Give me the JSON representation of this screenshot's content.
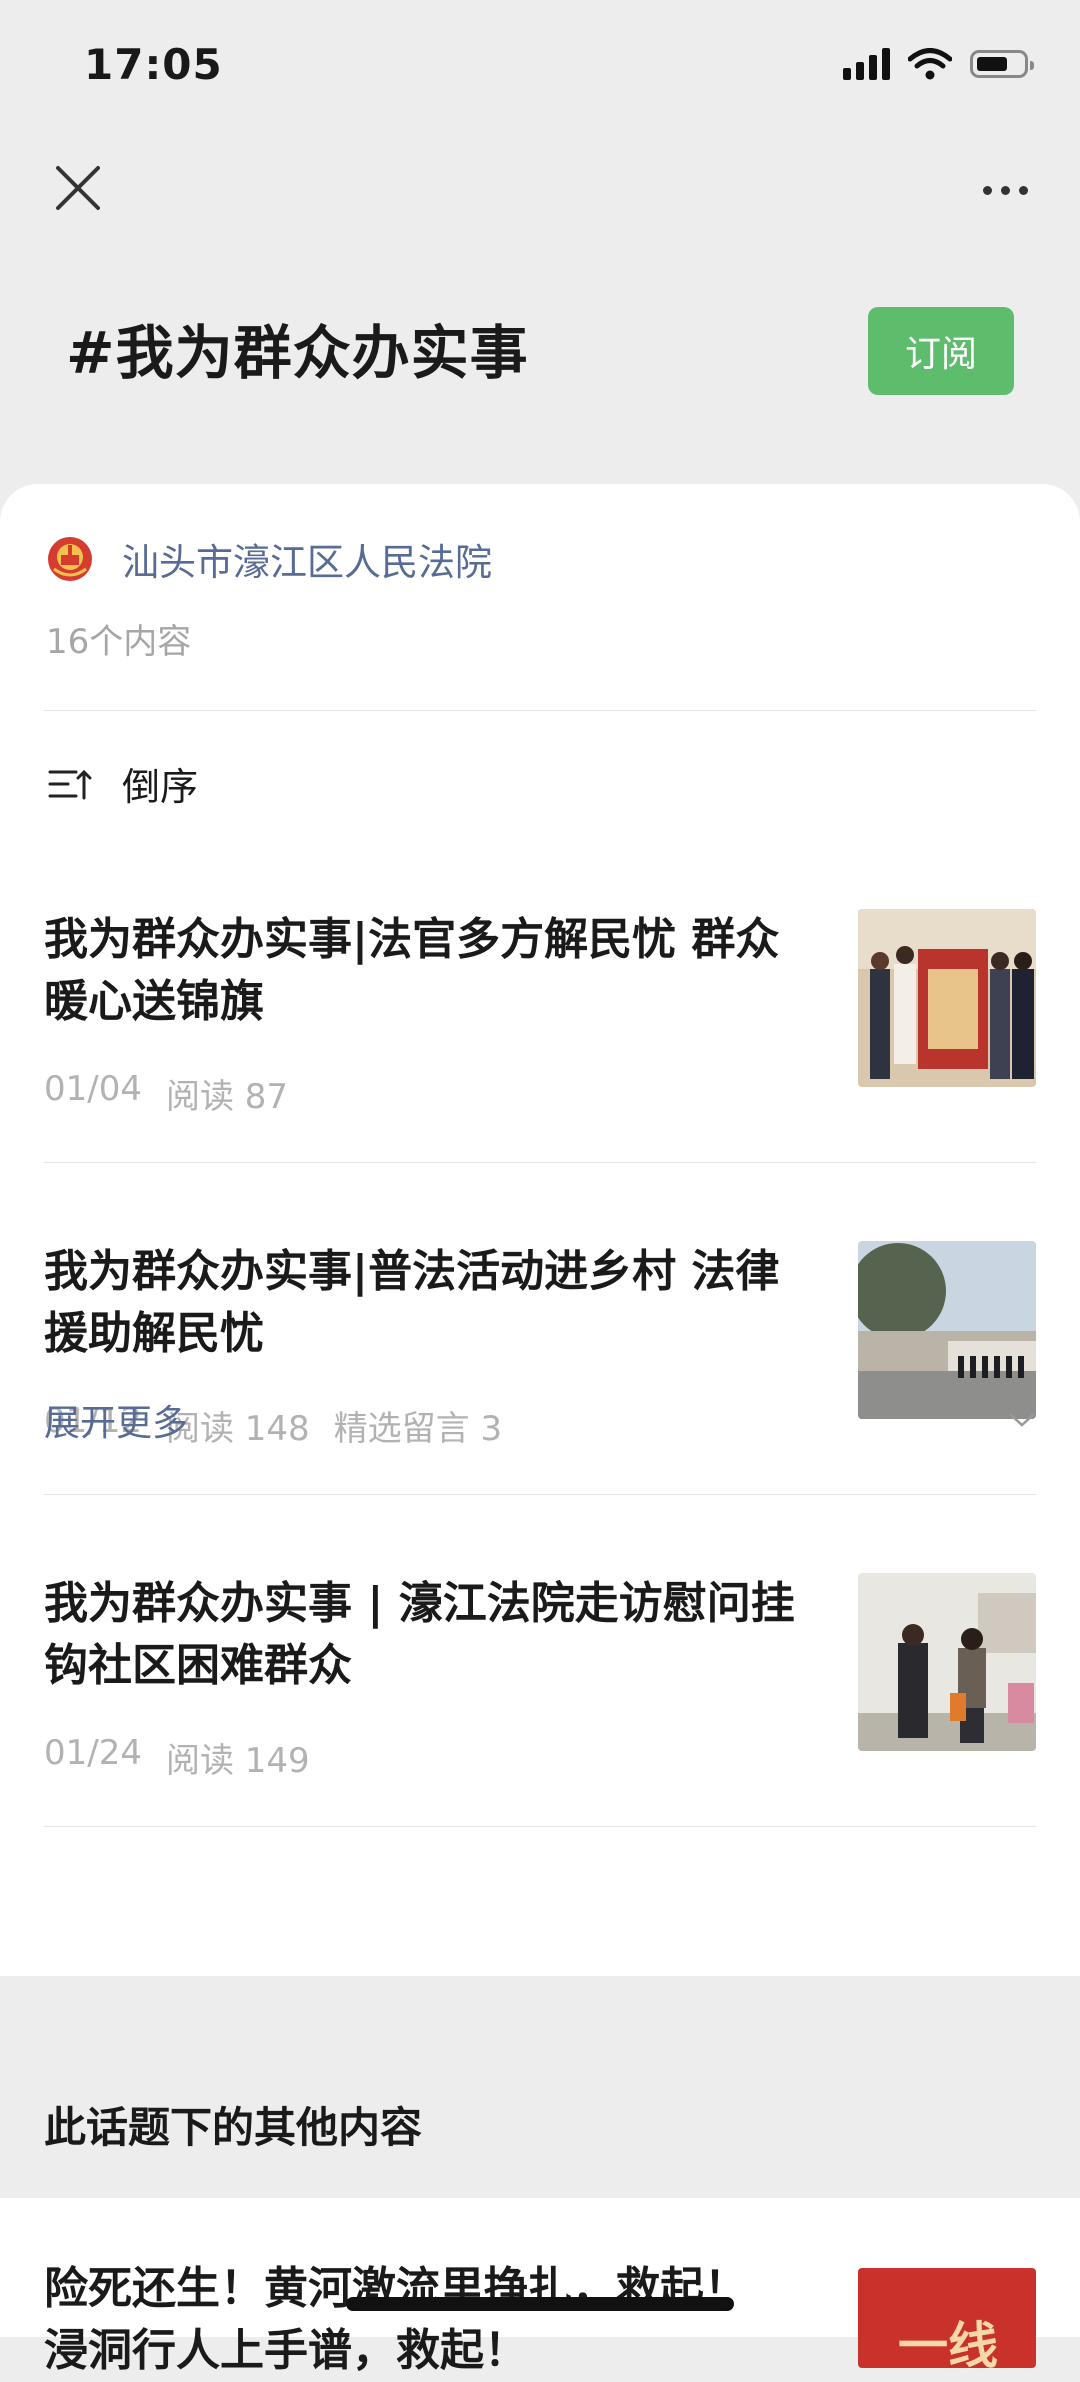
{
  "status_bar": {
    "time": "17:05",
    "battery_level": 0.58
  },
  "nav": {
    "close_icon": "close-icon",
    "more_icon": "more-horizontal-icon"
  },
  "topic": {
    "title": "#我为群众办实事",
    "subscribe_label": "订阅"
  },
  "source": {
    "name": "汕头市濠江区人民法院",
    "emblem_icon": "court-emblem-icon",
    "content_count": "16个内容"
  },
  "sort": {
    "label": "倒序",
    "icon": "sort-descending-icon"
  },
  "articles": [
    {
      "title": "我为群众办实事|法官多方解民忧 群众暖心送锦旗",
      "date": "01/04",
      "reads": "阅读 87",
      "comments": ""
    },
    {
      "title": "我为群众办实事|普法活动进乡村 法律援助解民忧",
      "date": "01/12",
      "reads": "阅读 148",
      "comments": "精选留言 3"
    },
    {
      "title": "我为群众办实事 | 濠江法院走访慰问挂钩社区困难群众",
      "date": "01/24",
      "reads": "阅读 149",
      "comments": ""
    }
  ],
  "expand": {
    "label": "展开更多",
    "icon": "chevron-down-icon"
  },
  "other": {
    "heading": "此话题下的其他内容",
    "first_item_title": "险死还生！黄河激流里挣扎，救起！",
    "first_item_title_line2": "浸洞行人上手谱，救起！",
    "first_item_thumb_text": "一线"
  },
  "colors": {
    "accent_green": "#5ebd6d",
    "link_blue": "#576b95",
    "meta_grey": "#b2b2b2",
    "background": "#ededed"
  }
}
